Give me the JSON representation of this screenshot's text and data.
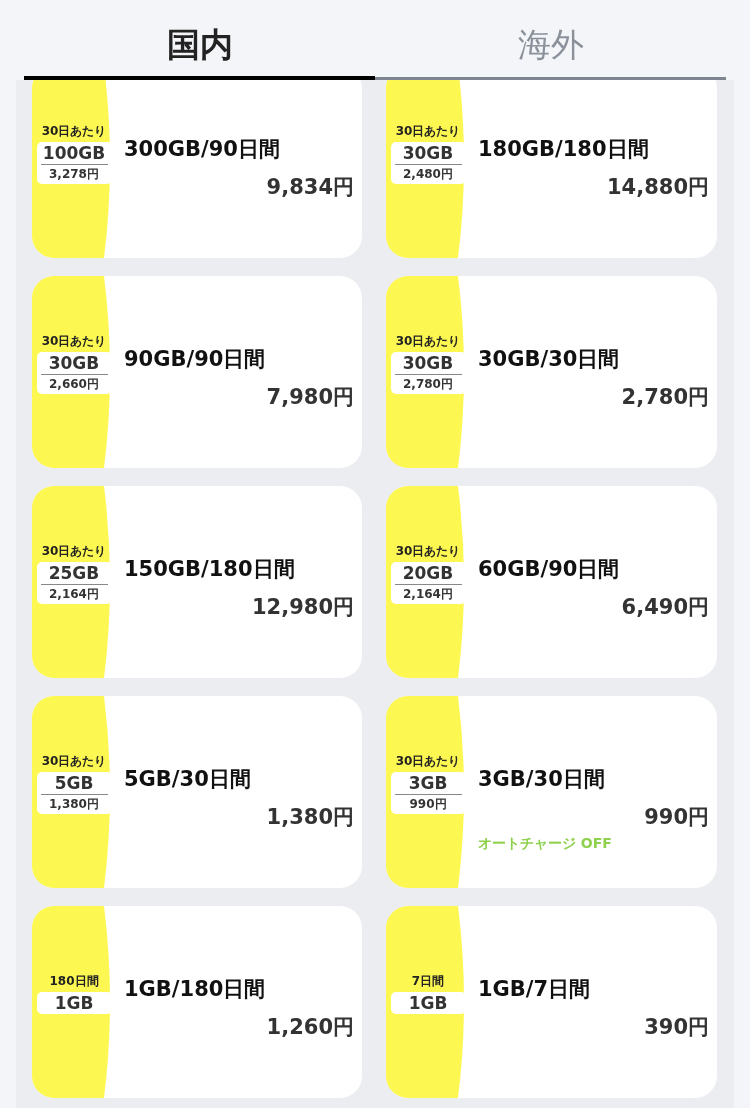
{
  "tabs": [
    {
      "label": "国内",
      "selected": true
    },
    {
      "label": "海外",
      "selected": false
    }
  ],
  "plans": [
    {
      "badge": {
        "period": "30日あたり",
        "amount": "100GB",
        "unit_price": "3,278円"
      },
      "title": "300GB/90日間",
      "price": "9,834円"
    },
    {
      "badge": {
        "period": "30日あたり",
        "amount": "30GB",
        "unit_price": "2,480円"
      },
      "title": "180GB/180日間",
      "price": "14,880円"
    },
    {
      "badge": {
        "period": "30日あたり",
        "amount": "30GB",
        "unit_price": "2,660円"
      },
      "title": "90GB/90日間",
      "price": "7,980円"
    },
    {
      "badge": {
        "period": "30日あたり",
        "amount": "30GB",
        "unit_price": "2,780円"
      },
      "title": "30GB/30日間",
      "price": "2,780円"
    },
    {
      "badge": {
        "period": "30日あたり",
        "amount": "25GB",
        "unit_price": "2,164円"
      },
      "title": "150GB/180日間",
      "price": "12,980円"
    },
    {
      "badge": {
        "period": "30日あたり",
        "amount": "20GB",
        "unit_price": "2,164円"
      },
      "title": "60GB/90日間",
      "price": "6,490円"
    },
    {
      "badge": {
        "period": "30日あたり",
        "amount": "5GB",
        "unit_price": "1,380円"
      },
      "title": "5GB/30日間",
      "price": "1,380円"
    },
    {
      "badge": {
        "period": "30日あたり",
        "amount": "3GB",
        "unit_price": "990円"
      },
      "title": "3GB/30日間",
      "price": "990円",
      "note": "オートチャージ OFF"
    },
    {
      "badge": {
        "period": "180日間",
        "amount": "1GB"
      },
      "title": "1GB/180日間",
      "price": "1,260円"
    },
    {
      "badge": {
        "period": "7日間",
        "amount": "1GB"
      },
      "title": "1GB/7日間",
      "price": "390円"
    }
  ]
}
